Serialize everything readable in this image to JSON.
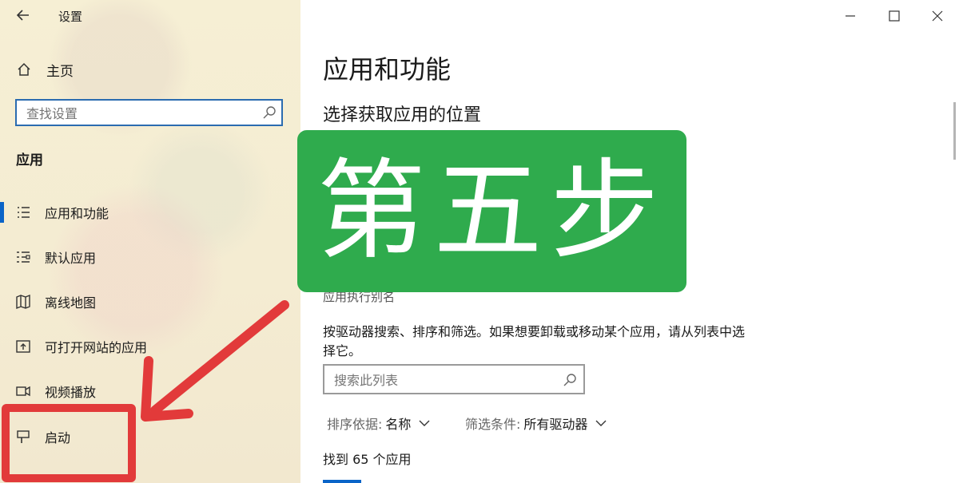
{
  "window": {
    "title": "设置",
    "controls": [
      "minimize-icon",
      "maximize-icon",
      "close-icon"
    ]
  },
  "sidebar": {
    "home_label": "主页",
    "search_placeholder": "查找设置",
    "section_title": "应用",
    "items": [
      {
        "label": "应用和功能",
        "icon": "list-icon",
        "active": true
      },
      {
        "label": "默认应用",
        "icon": "default-apps-icon"
      },
      {
        "label": "离线地图",
        "icon": "map-icon"
      },
      {
        "label": "可打开网站的应用",
        "icon": "open-website-icon"
      },
      {
        "label": "视频播放",
        "icon": "video-icon"
      },
      {
        "label": "启动",
        "icon": "startup-icon"
      }
    ]
  },
  "main": {
    "title": "应用和功能",
    "subtitle": "选择获取应用的位置",
    "partial_text": "应用执行别名",
    "description": "按驱动器搜索、排序和筛选。如果想要卸载或移动某个应用，请从列表中选择它。",
    "list_search_placeholder": "搜索此列表",
    "sort_label": "排序依据:",
    "sort_value": "名称",
    "filter_label": "筛选条件:",
    "filter_value": "所有驱动器",
    "count_text": "找到 65 个应用"
  },
  "overlay": {
    "banner_text": "第五步",
    "banner_color": "#2fab4d",
    "annotation_color": "#e23a3a"
  }
}
